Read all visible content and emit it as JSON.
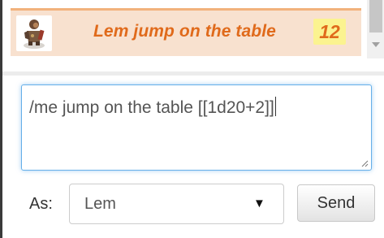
{
  "chat": {
    "message": {
      "avatar_icon": "character-token-icon",
      "text": "Lem jump on the table",
      "roll_result": "12",
      "colors": {
        "text": "#e06a1b",
        "background": "#f8e1cf",
        "roll_highlight": "#fbf390"
      }
    }
  },
  "input": {
    "value": "/me jump on the table [[1d20+2]]"
  },
  "controls": {
    "as_label": "As:",
    "as_selected": "Lem",
    "dropdown_arrow": "▼",
    "send_label": "Send"
  }
}
